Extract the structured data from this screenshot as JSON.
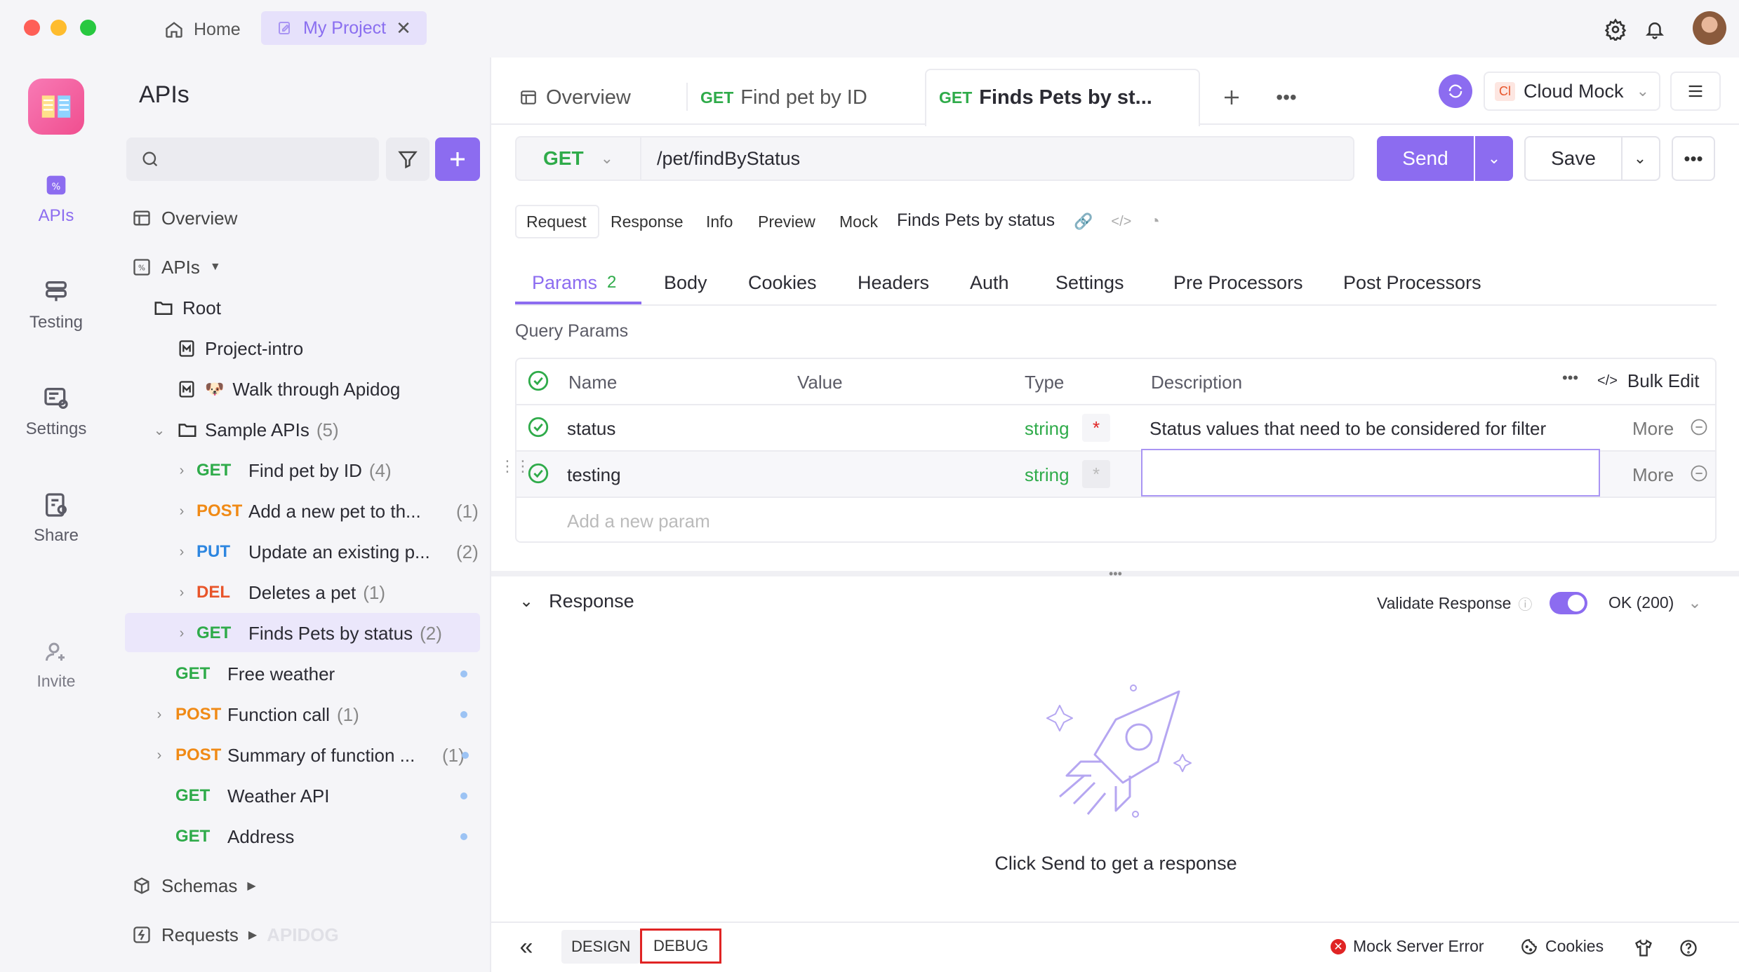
{
  "titlebar": {
    "home_label": "Home",
    "project_tab_label": "My Project"
  },
  "rail": {
    "items": [
      {
        "label": "APIs"
      },
      {
        "label": "Testing"
      },
      {
        "label": "Settings"
      },
      {
        "label": "Share"
      },
      {
        "label": "Invite"
      }
    ]
  },
  "sidebar": {
    "title": "APIs",
    "search_placeholder": "",
    "overview": "Overview",
    "apis_label": "APIs",
    "root": "Root",
    "project_intro": "Project-intro",
    "walk_through": "Walk through Apidog",
    "sample_apis": "Sample APIs",
    "sample_count": "(5)",
    "endpoints": [
      {
        "method": "GET",
        "name": "Find pet by ID",
        "count": "(4)"
      },
      {
        "method": "POST",
        "name": "Add a new pet to th...",
        "count": "(1)"
      },
      {
        "method": "PUT",
        "name": "Update an existing p...",
        "count": "(2)"
      },
      {
        "method": "DEL",
        "name": "Deletes a pet",
        "count": "(1)"
      },
      {
        "method": "GET",
        "name": "Finds Pets by status",
        "count": "(2)"
      }
    ],
    "top_items": [
      {
        "method": "GET",
        "name": "Free weather",
        "count": ""
      },
      {
        "method": "POST",
        "name": "Function call",
        "count": "(1)"
      },
      {
        "method": "POST",
        "name": "Summary of function ...",
        "count": "(1)"
      },
      {
        "method": "GET",
        "name": "Weather API",
        "count": ""
      },
      {
        "method": "GET",
        "name": "Address",
        "count": ""
      }
    ],
    "schemas": "Schemas",
    "requests": "Requests",
    "watermark": "APIDOG"
  },
  "tabs": {
    "overview": "Overview",
    "tab1_method": "GET",
    "tab1_name": "Find pet by ID",
    "tab2_method": "GET",
    "tab2_name": "Finds Pets by st...",
    "env_badge": "Cl",
    "env_name": "Cloud Mock"
  },
  "request": {
    "method": "GET",
    "path": "/pet/findByStatus",
    "send": "Send",
    "save": "Save"
  },
  "subtabs": {
    "items": [
      "Request",
      "Response",
      "Info",
      "Preview",
      "Mock"
    ],
    "endpoint_title": "Finds Pets by status"
  },
  "param_tabs": {
    "items": [
      "Params",
      "Body",
      "Cookies",
      "Headers",
      "Auth",
      "Settings",
      "Pre Processors",
      "Post Processors"
    ],
    "params_count": "2"
  },
  "query_params": {
    "title": "Query Params",
    "headers": [
      "Name",
      "Value",
      "Type",
      "Description"
    ],
    "bulk_edit": "Bulk Edit",
    "rows": [
      {
        "name": "status",
        "type": "string",
        "required": "*",
        "description": "Status values that need to be considered for filter",
        "more": "More"
      },
      {
        "name": "testing",
        "type": "string",
        "required": "*",
        "description": "",
        "more": "More"
      }
    ],
    "add_placeholder": "Add a new param"
  },
  "response": {
    "title": "Response",
    "validate_label": "Validate Response",
    "status": "OK (200)",
    "empty_text": "Click Send to get a response"
  },
  "bottombar": {
    "design": "DESIGN",
    "debug": "DEBUG",
    "mock_error": "Mock Server Error",
    "cookies": "Cookies"
  },
  "colors": {
    "accent": "#8c6cf0",
    "get": "#2fab4a",
    "post": "#f08a16",
    "put": "#2d86e0",
    "del": "#e8552a"
  }
}
